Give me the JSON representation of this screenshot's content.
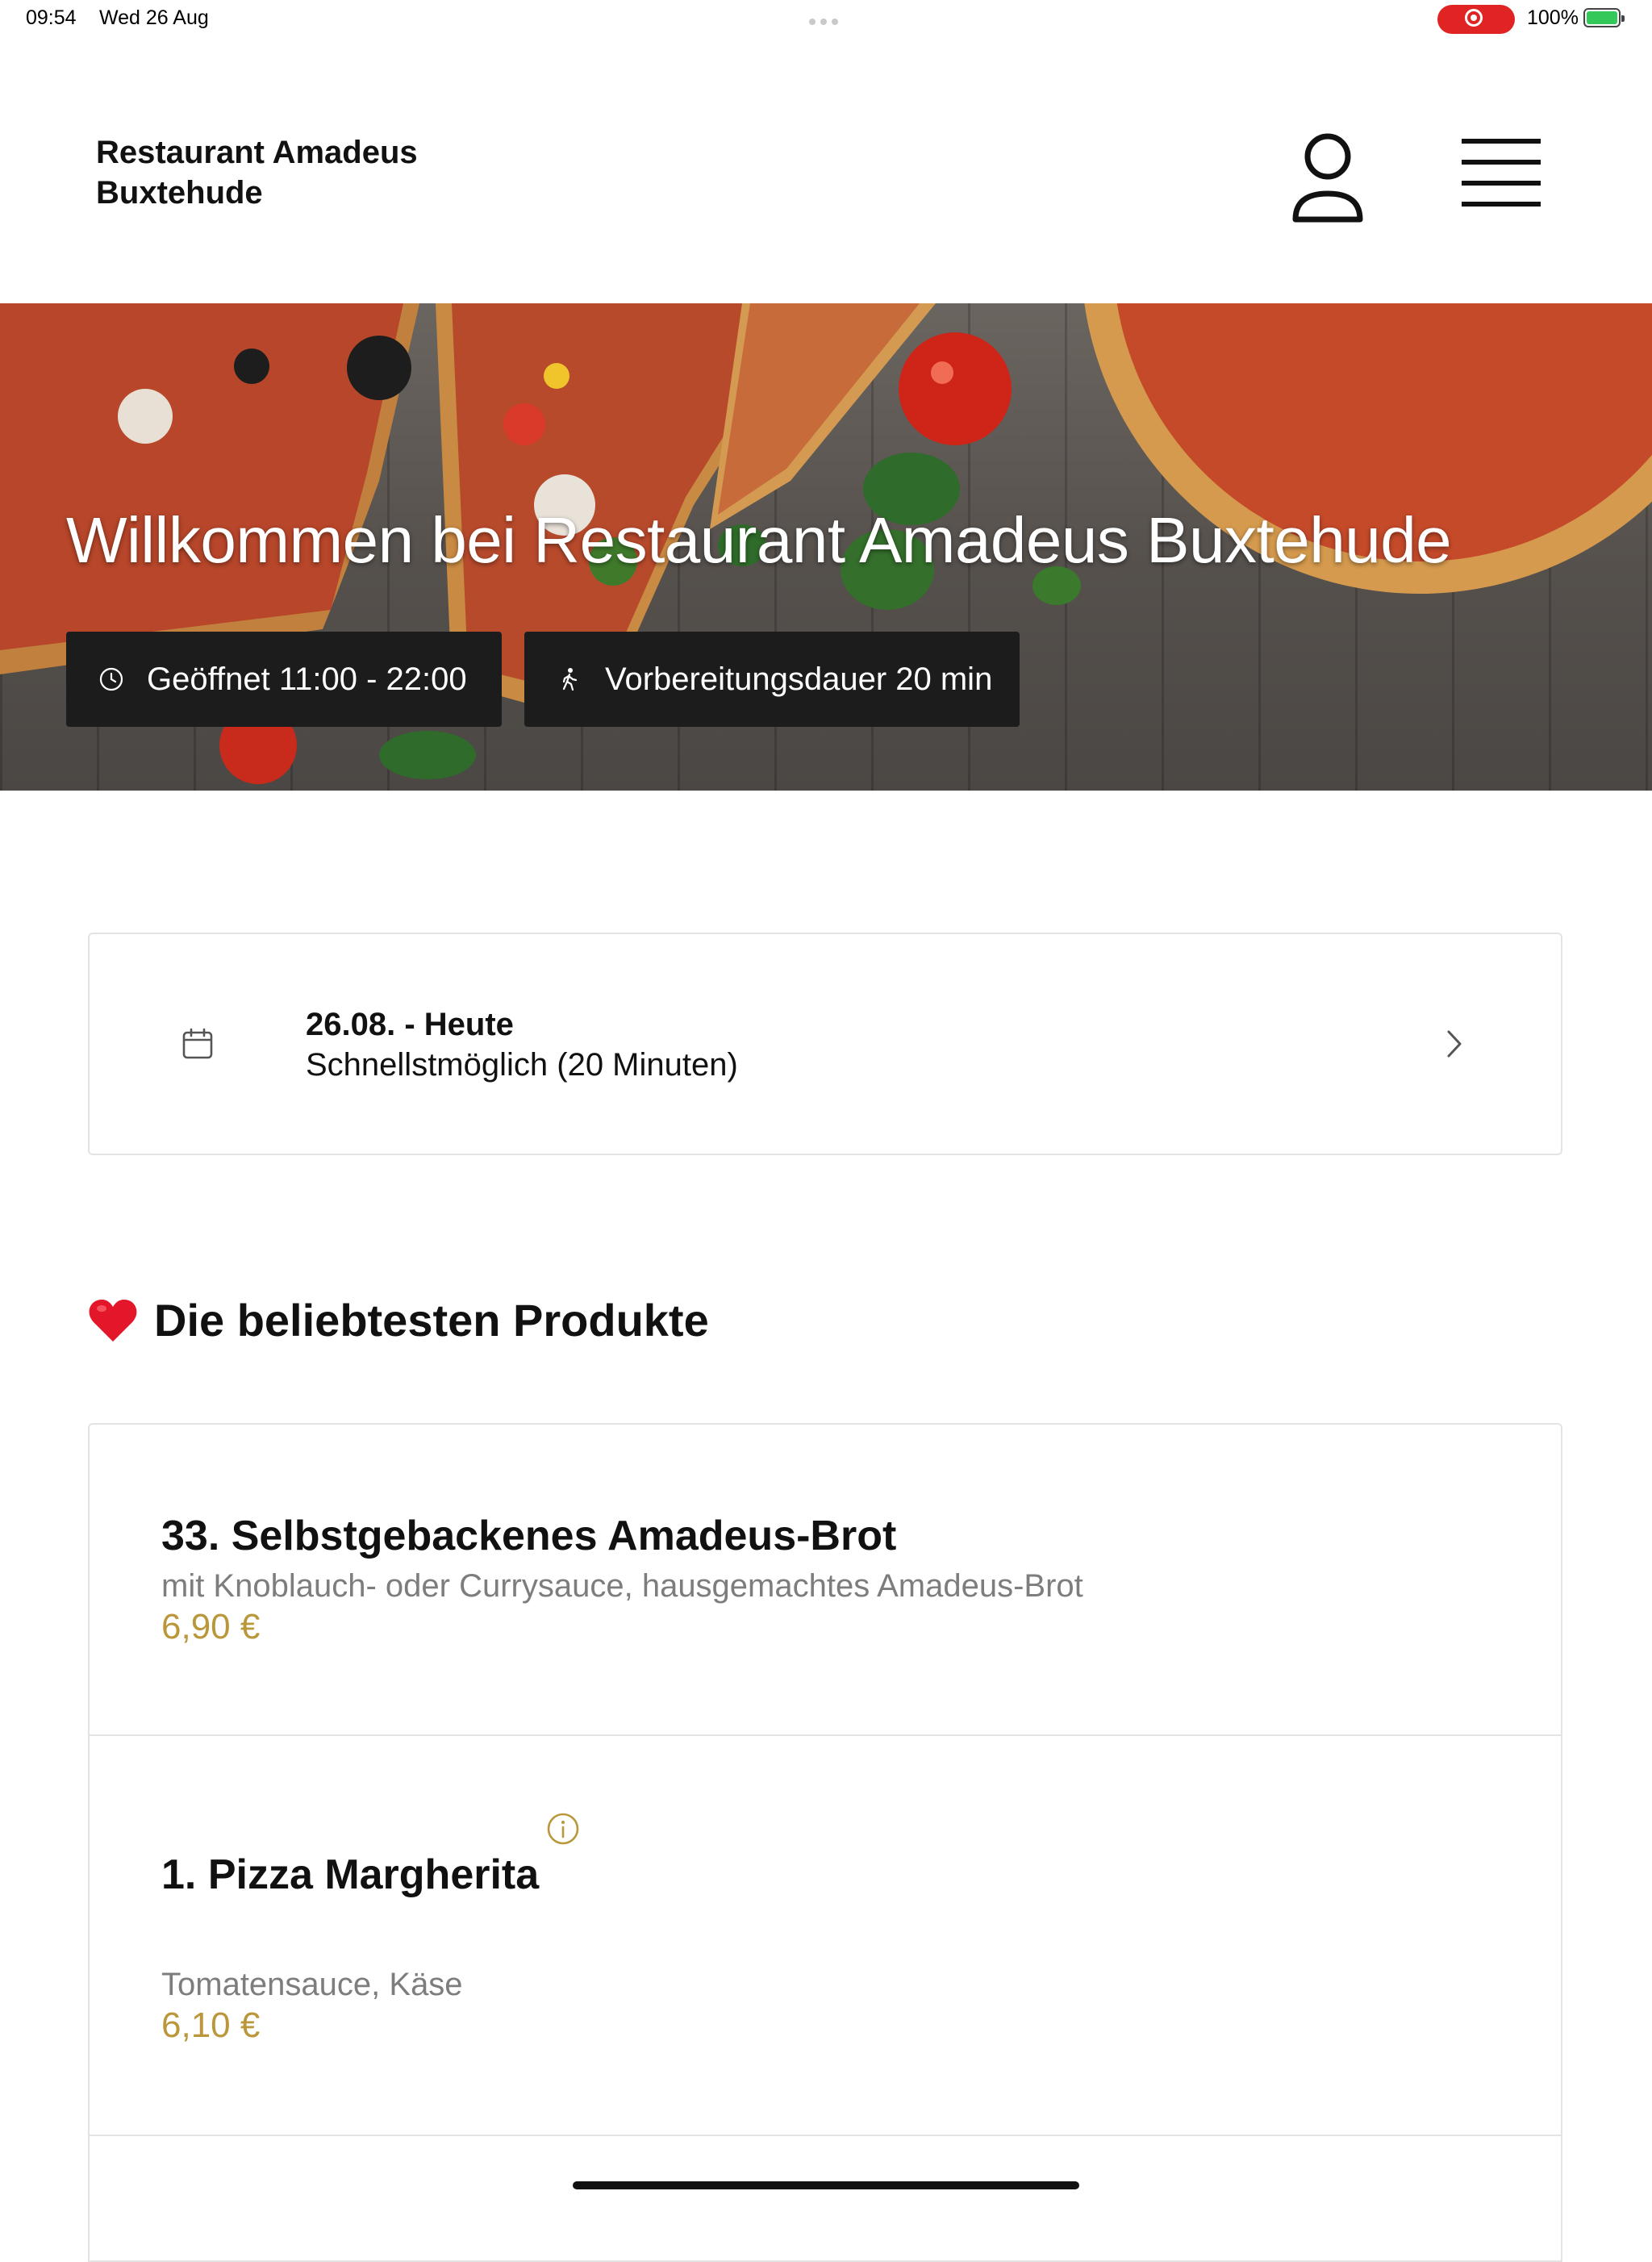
{
  "status_bar": {
    "time": "09:54",
    "date": "Wed 26 Aug",
    "battery": "100%"
  },
  "header": {
    "brand_line1": "Restaurant Amadeus",
    "brand_line2": "Buxtehude",
    "icons": [
      "user-icon",
      "hamburger-menu-icon"
    ]
  },
  "hero": {
    "title": "Willkommen bei Restaurant Amadeus Buxtehude",
    "opening_hours": "Geöffnet 11:00 - 22:00",
    "preparation_time": "Vorbereitungsdauer 20 min",
    "icons": [
      "clock-icon",
      "walking-icon"
    ]
  },
  "schedule": {
    "date_label": "26.08. - Heute",
    "time_label": "Schnellstmöglich (20 Minuten)",
    "icons": [
      "calendar-icon",
      "chevron-right-icon"
    ]
  },
  "popular": {
    "title": "Die beliebtesten Produkte",
    "icon": "heart-icon",
    "products": [
      {
        "name": "33. Selbstgebackenes Amadeus-Brot",
        "description": "mit Knoblauch- oder Currysauce, hausgemachtes Amadeus-Brot",
        "price": "6,90 €"
      },
      {
        "name": "1. Pizza Margherita",
        "description": "Tomatensauce, Käse",
        "price": "6,10 €",
        "icon": "info-icon"
      }
    ]
  },
  "colors": {
    "accent_price": "#b9973a",
    "pill_background": "#1c1c1c",
    "record_indicator": "#e02424",
    "battery_fill": "#34c759"
  }
}
